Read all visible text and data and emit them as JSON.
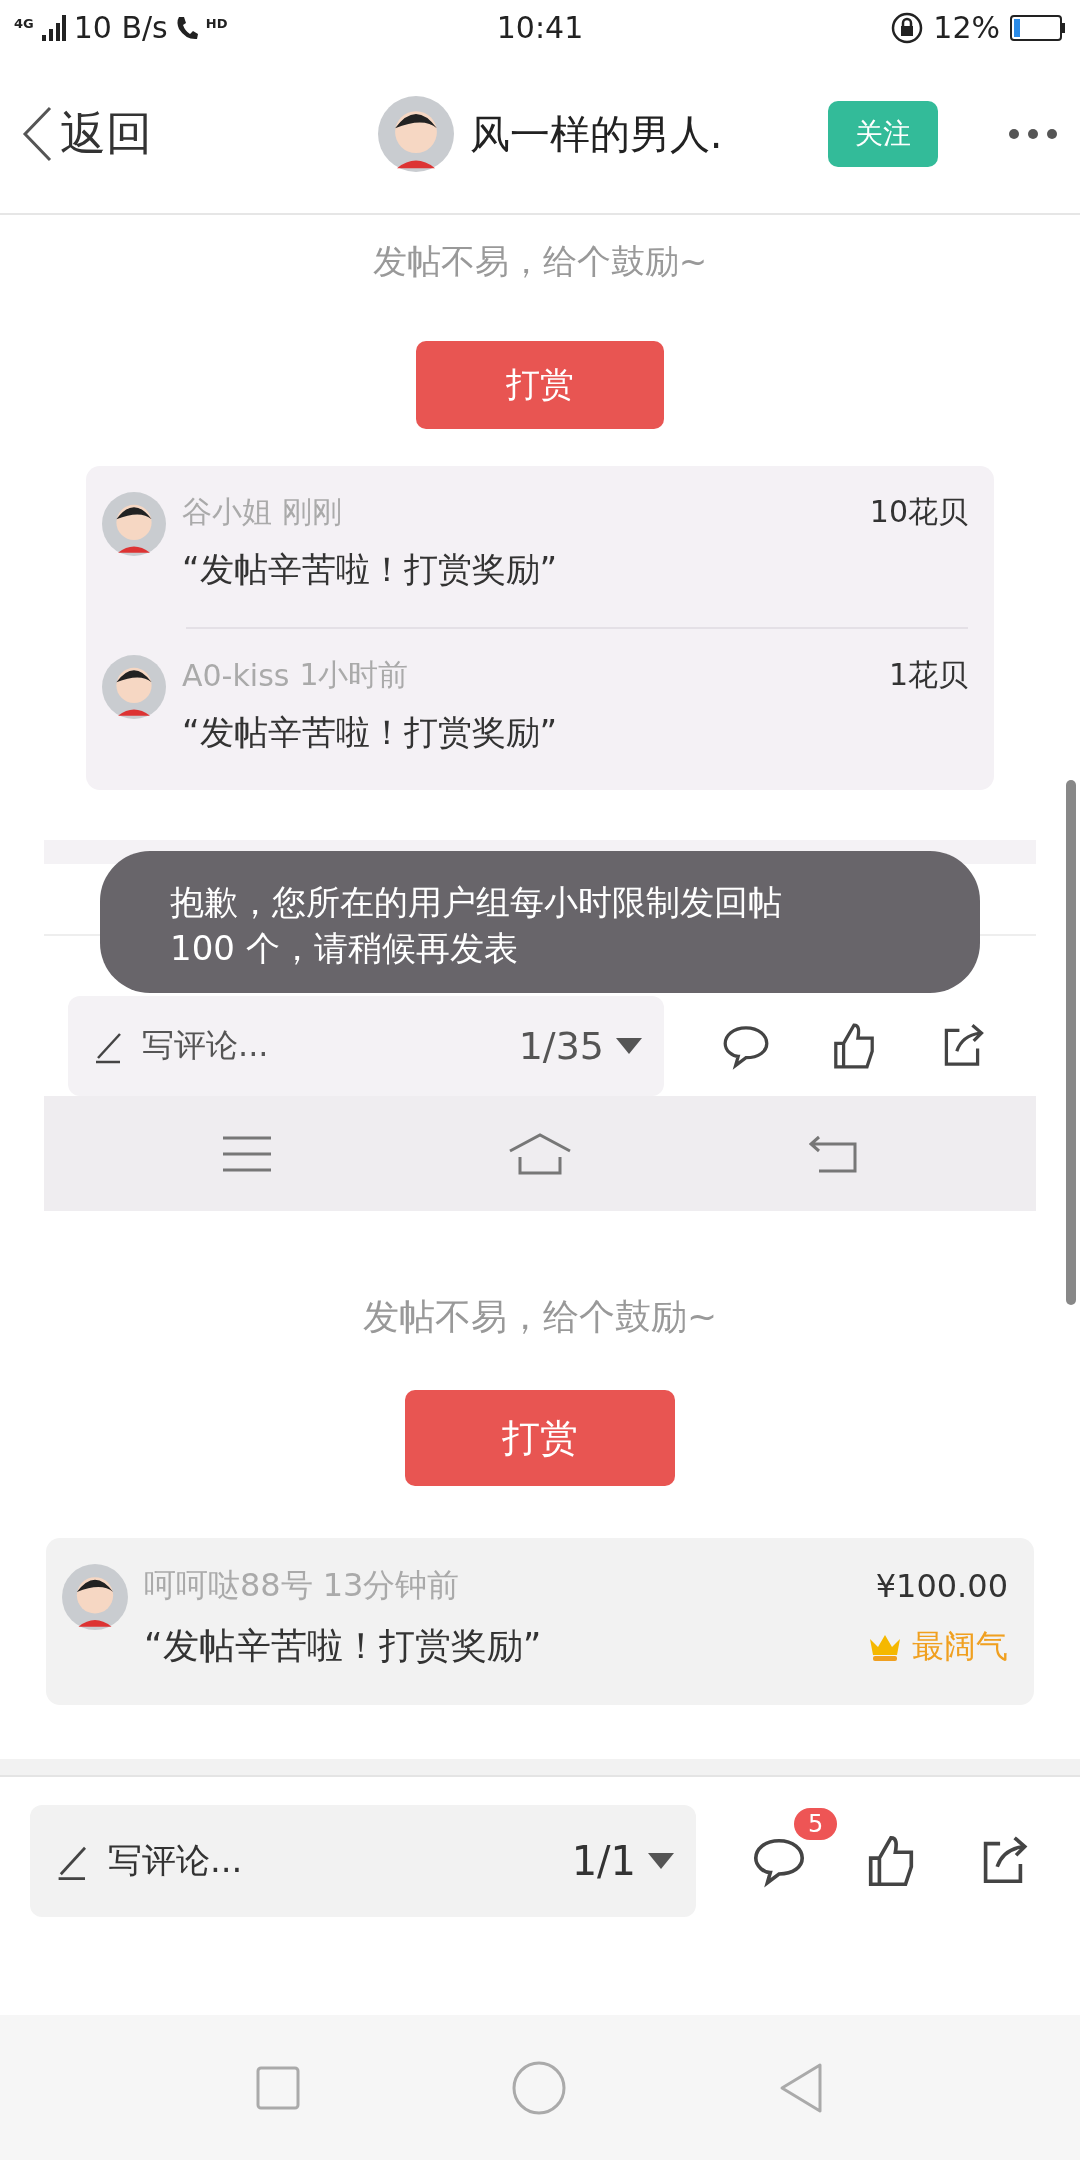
{
  "status_bar": {
    "network": "4G",
    "speed": "10 B/s",
    "call": "HD",
    "time": "10:41",
    "battery": "12%"
  },
  "header": {
    "back": "返回",
    "author": "风一样的男人.",
    "follow": "关注"
  },
  "post_image": {
    "encourage": "发帖不易，给个鼓励~",
    "reward_button": "打赏",
    "rewards": [
      {
        "name": "谷小姐",
        "time": "刚刚",
        "amount": "10花贝",
        "message": "“发帖辛苦啦！打赏奖励”"
      },
      {
        "name": "A0-kiss",
        "time": "1小时前",
        "amount": "1花贝",
        "message": "“发帖辛苦啦！打赏奖励”"
      }
    ],
    "comment_bar": {
      "placeholder": "写评论...",
      "page": "1/35"
    },
    "toast": "抱歉，您所在的用户组每小时限制发回帖100 个，请稍候再发表"
  },
  "encourage": "发帖不易，给个鼓励~",
  "reward_button": "打赏",
  "rewards": [
    {
      "name": "呵呵哒88号",
      "time": "13分钟前",
      "message": "“发帖辛苦啦！打赏奖励”",
      "amount": "¥100.00",
      "tag": "最阔气"
    }
  ],
  "comment_bar": {
    "placeholder": "写评论...",
    "page": "1/1",
    "badge": "5"
  }
}
